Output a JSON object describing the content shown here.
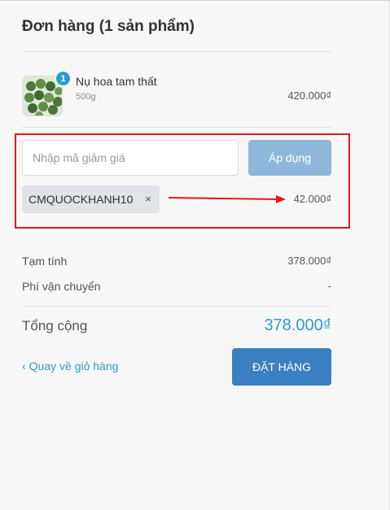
{
  "order": {
    "title": "Đơn hàng (1 sản phẩm)"
  },
  "product": {
    "name": "Nụ hoa tam thất",
    "variant": "500g",
    "price": "420.000₫",
    "quantity": "1"
  },
  "discount": {
    "placeholder": "Nhập mã giảm giá",
    "apply_label": "Áp dụng",
    "applied_code": "CMQUOCKHANH10",
    "remove_symbol": "×",
    "amount": "42.000₫"
  },
  "summary": {
    "subtotal_label": "Tạm tính",
    "subtotal_value": "378.000₫",
    "shipping_label": "Phí vận chuyển",
    "shipping_value": "-",
    "total_label": "Tổng cộng",
    "total_value": "378.000₫"
  },
  "actions": {
    "back_label": "Quay về giỏ hàng",
    "order_label": "ĐẶT HÀNG"
  },
  "colors": {
    "accent": "#2a9dcc",
    "primary_button": "#3a7fc1",
    "apply_button": "#8fb7db",
    "annotation_red": "#e5171b"
  }
}
